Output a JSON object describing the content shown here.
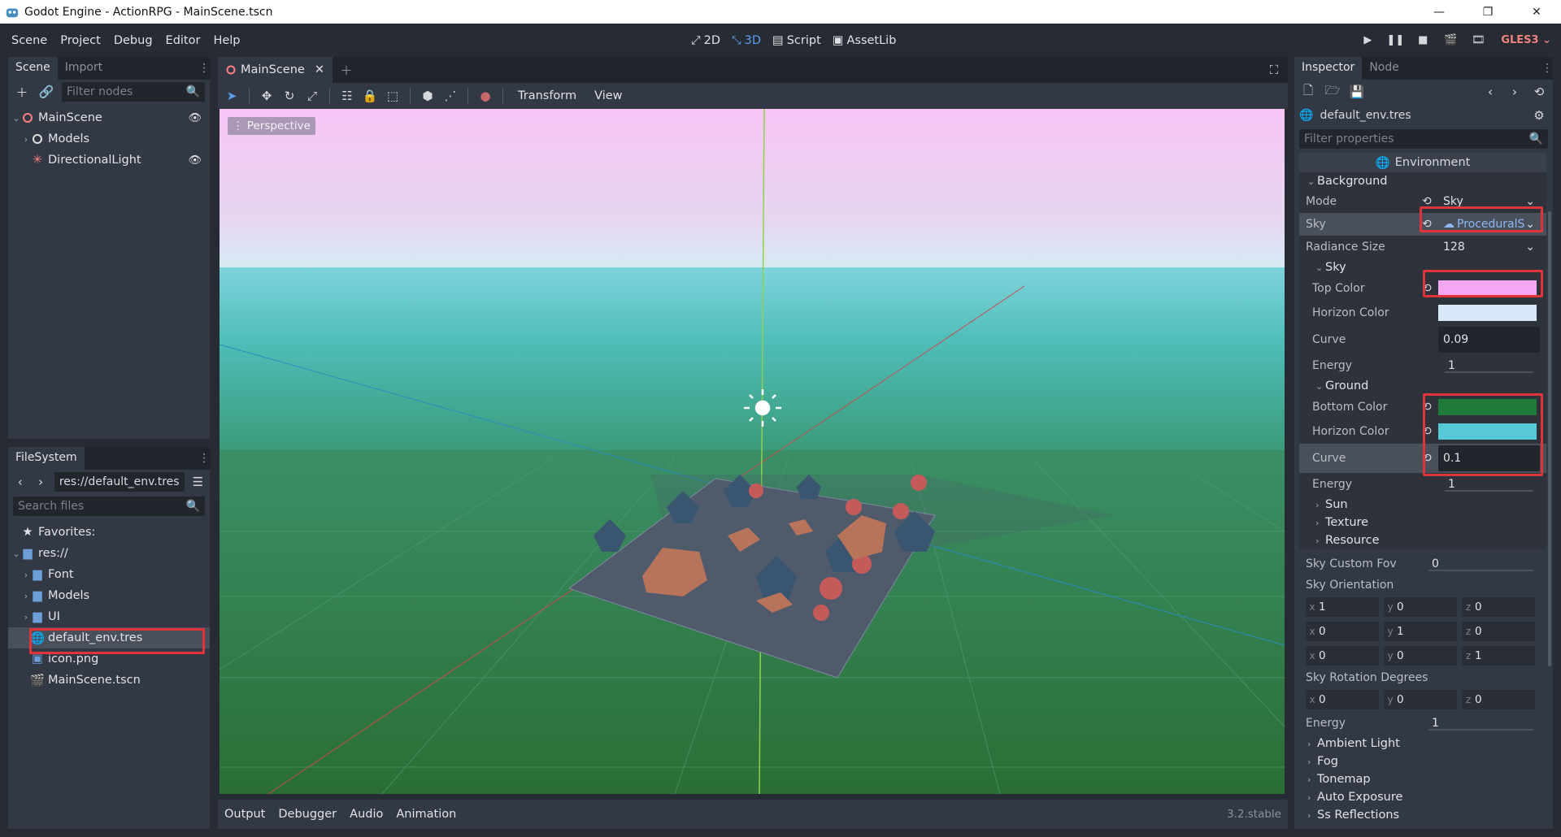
{
  "window": {
    "title": "Godot Engine - ActionRPG - MainScene.tscn"
  },
  "menubar": {
    "menus": [
      "Scene",
      "Project",
      "Debug",
      "Editor",
      "Help"
    ],
    "modes": [
      {
        "label": "2D",
        "icon": "2d-mode-icon"
      },
      {
        "label": "3D",
        "icon": "3d-mode-icon"
      },
      {
        "label": "Script",
        "icon": "script-icon"
      },
      {
        "label": "AssetLib",
        "icon": "assetlib-icon"
      }
    ],
    "renderer": "GLES3"
  },
  "scene_panel": {
    "tabs": [
      "Scene",
      "Import"
    ],
    "filter_placeholder": "Filter nodes",
    "nodes": [
      {
        "label": "MainScene",
        "icon": "node3d-icon",
        "eye": true
      },
      {
        "label": "Models",
        "icon": "node3d-icon",
        "eye": false
      },
      {
        "label": "DirectionalLight",
        "icon": "light-icon",
        "eye": true
      }
    ]
  },
  "filesystem": {
    "tab": "FileSystem",
    "path": "res://default_env.tres",
    "search_placeholder": "Search files",
    "favorites": "Favorites:",
    "root": "res://",
    "folders": [
      "Font",
      "Models",
      "UI"
    ],
    "files": [
      {
        "label": "default_env.tres",
        "icon": "environment-icon"
      },
      {
        "label": "icon.png",
        "icon": "image-icon"
      },
      {
        "label": "MainScene.tscn",
        "icon": "scene-icon"
      }
    ]
  },
  "viewport": {
    "scene_tab": "MainScene",
    "menus": [
      "Transform",
      "View"
    ],
    "perspective": "Perspective",
    "bottom_tabs": [
      "Output",
      "Debugger",
      "Audio",
      "Animation"
    ],
    "version": "3.2.stable"
  },
  "inspector": {
    "tabs": [
      "Inspector",
      "Node"
    ],
    "resource": "default_env.tres",
    "filter_placeholder": "Filter properties",
    "header": "Environment",
    "background_section": "Background",
    "mode": {
      "label": "Mode",
      "value": "Sky"
    },
    "sky": {
      "label": "Sky",
      "value": "ProceduralS"
    },
    "radiance": {
      "label": "Radiance Size",
      "value": "128"
    },
    "sky_sub": "Sky",
    "top_color": {
      "label": "Top Color",
      "color": "#f6a7f4"
    },
    "horizon_color": {
      "label": "Horizon Color",
      "color": "#d7e8f8"
    },
    "sky_curve": {
      "label": "Curve",
      "value": "0.09"
    },
    "sky_energy": {
      "label": "Energy",
      "value": "1"
    },
    "ground_sub": "Ground",
    "bottom_color": {
      "label": "Bottom Color",
      "color": "#1f7a3a"
    },
    "ground_horizon_color": {
      "label": "Horizon Color",
      "color": "#57c8d8"
    },
    "ground_curve": {
      "label": "Curve",
      "value": "0.1"
    },
    "ground_energy": {
      "label": "Energy",
      "value": "1"
    },
    "collapsed": [
      "Sun",
      "Texture",
      "Resource"
    ],
    "sky_custom_fov": {
      "label": "Sky Custom Fov",
      "value": "0"
    },
    "sky_orientation": {
      "label": "Sky Orientation",
      "rows": [
        [
          {
            "ax": "x",
            "v": "1"
          },
          {
            "ax": "y",
            "v": "0"
          },
          {
            "ax": "z",
            "v": "0"
          }
        ],
        [
          {
            "ax": "x",
            "v": "0"
          },
          {
            "ax": "y",
            "v": "1"
          },
          {
            "ax": "z",
            "v": "0"
          }
        ],
        [
          {
            "ax": "x",
            "v": "0"
          },
          {
            "ax": "y",
            "v": "0"
          },
          {
            "ax": "z",
            "v": "1"
          }
        ]
      ]
    },
    "sky_rotation": {
      "label": "Sky Rotation Degrees",
      "row": [
        {
          "ax": "x",
          "v": "0"
        },
        {
          "ax": "y",
          "v": "0"
        },
        {
          "ax": "z",
          "v": "0"
        }
      ]
    },
    "energy": {
      "label": "Energy",
      "value": "1"
    },
    "more_sections": [
      "Ambient Light",
      "Fog",
      "Tonemap",
      "Auto Exposure",
      "Ss Reflections"
    ]
  },
  "colors": {
    "highlight": "#e0343a",
    "accent": "#5c9ff1",
    "sky_top": "#f6c8f7",
    "sky_horizon": "#5fcad2",
    "ground": "#2e7d44"
  }
}
